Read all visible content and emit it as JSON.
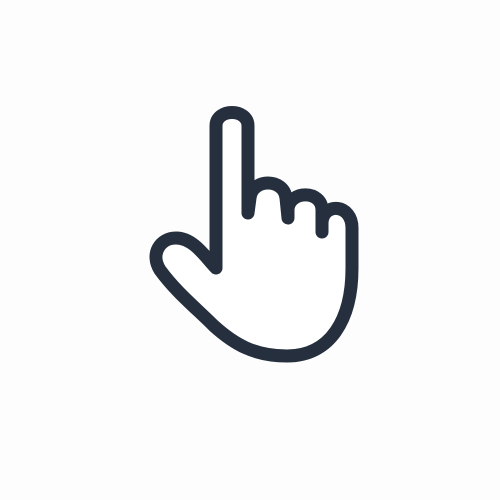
{
  "icon": {
    "name": "hand-pointer-icon",
    "stroke_color": "#262f3d",
    "background_color": "#fdfdfd",
    "fill_color": "#ffffff"
  }
}
